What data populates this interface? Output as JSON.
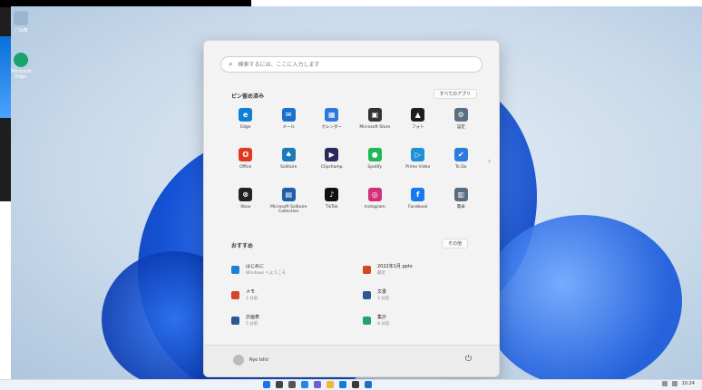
{
  "desktop": {
    "icons": [
      {
        "name": "recycle-bin-icon",
        "label": "ごみ箱",
        "color": "#9bb6d2"
      },
      {
        "name": "edge-desktop-icon",
        "label": "Microsoft Edge",
        "color": "#1aa36b"
      }
    ]
  },
  "start_menu": {
    "search_placeholder": "検索するには、ここに入力します",
    "pinned": {
      "title": "ピン留め済み",
      "all_apps_button": "すべてのアプリ",
      "apps": [
        {
          "label": "Edge",
          "icon": "edge-icon",
          "color": "#0f7fd6",
          "glyph": "e"
        },
        {
          "label": "メール",
          "icon": "mail-icon",
          "color": "#1b6fcf",
          "glyph": "✉"
        },
        {
          "label": "カレンダー",
          "icon": "calendar-icon",
          "color": "#2b79d8",
          "glyph": "▦"
        },
        {
          "label": "Microsoft Store",
          "icon": "store-icon",
          "color": "#333333",
          "glyph": "▣"
        },
        {
          "label": "フォト",
          "icon": "photos-icon",
          "color": "#1f1f1f",
          "glyph": "▲"
        },
        {
          "label": "設定",
          "icon": "settings-icon",
          "color": "#5b6e84",
          "glyph": "⚙"
        },
        {
          "label": "Office",
          "icon": "office-icon",
          "color": "#e03a1e",
          "glyph": "O"
        },
        {
          "label": "Solitaire",
          "icon": "solitaire-icon",
          "color": "#1d7ab8",
          "glyph": "♠"
        },
        {
          "label": "Clipchamp",
          "icon": "clipchamp-icon",
          "color": "#2a2a5e",
          "glyph": "▶"
        },
        {
          "label": "Spotify",
          "icon": "spotify-icon",
          "color": "#1db954",
          "glyph": "●"
        },
        {
          "label": "Prime Video",
          "icon": "prime-video-icon",
          "color": "#1f8fd6",
          "glyph": "▷"
        },
        {
          "label": "To Do",
          "icon": "todo-icon",
          "color": "#2d7be0",
          "glyph": "✔"
        },
        {
          "label": "Xbox",
          "icon": "xbox-icon",
          "color": "#222222",
          "glyph": "⊗"
        },
        {
          "label": "Microsoft Solitaire Collection",
          "icon": "solitaire-collection-icon",
          "color": "#1e5fa8",
          "glyph": "▤"
        },
        {
          "label": "TikTok",
          "icon": "tiktok-icon",
          "color": "#111111",
          "glyph": "♪"
        },
        {
          "label": "Instagram",
          "icon": "instagram-icon",
          "color": "#d1307a",
          "glyph": "◎"
        },
        {
          "label": "Facebook",
          "icon": "facebook-icon",
          "color": "#1877f2",
          "glyph": "f"
        },
        {
          "label": "電卓",
          "icon": "calculator-icon",
          "color": "#5a6c7d",
          "glyph": "▥"
        }
      ]
    },
    "recommended": {
      "title": "おすすめ",
      "more_button": "その他",
      "items": [
        {
          "name": "はじめに",
          "time": "Windows へようこそ",
          "icon": "get-started-icon",
          "color": "#1a82d8"
        },
        {
          "name": "2022年1月.pptx",
          "time": "最近",
          "icon": "pptx-file-icon",
          "color": "#d24726"
        },
        {
          "name": "メモ",
          "time": "1 分前",
          "icon": "note-file-icon",
          "color": "#d24726"
        },
        {
          "name": "文書",
          "time": "3 分前",
          "icon": "doc-file-icon",
          "color": "#2b5797"
        },
        {
          "name": "計画表",
          "time": "5 分前",
          "icon": "plan-file-icon",
          "color": "#2b5797"
        },
        {
          "name": "集計",
          "time": "8 分前",
          "icon": "sheet-file-icon",
          "color": "#21a366"
        }
      ]
    },
    "footer": {
      "user_name": "Ryo Ishii",
      "power_icon": "power-icon"
    }
  },
  "taskbar": {
    "icons": [
      {
        "name": "start-icon",
        "color": "#1a73e8"
      },
      {
        "name": "search-icon",
        "color": "#444444"
      },
      {
        "name": "task-view-icon",
        "color": "#555555"
      },
      {
        "name": "widgets-icon",
        "color": "#1e88e5"
      },
      {
        "name": "chat-icon",
        "color": "#6b5fd3"
      },
      {
        "name": "explorer-icon",
        "color": "#f2b632"
      },
      {
        "name": "edge-taskbar-icon",
        "color": "#0f7fd6"
      },
      {
        "name": "store-taskbar-icon",
        "color": "#3a3a3a"
      },
      {
        "name": "mail-taskbar-icon",
        "color": "#1b6fcf"
      }
    ],
    "clock": "10:24"
  }
}
